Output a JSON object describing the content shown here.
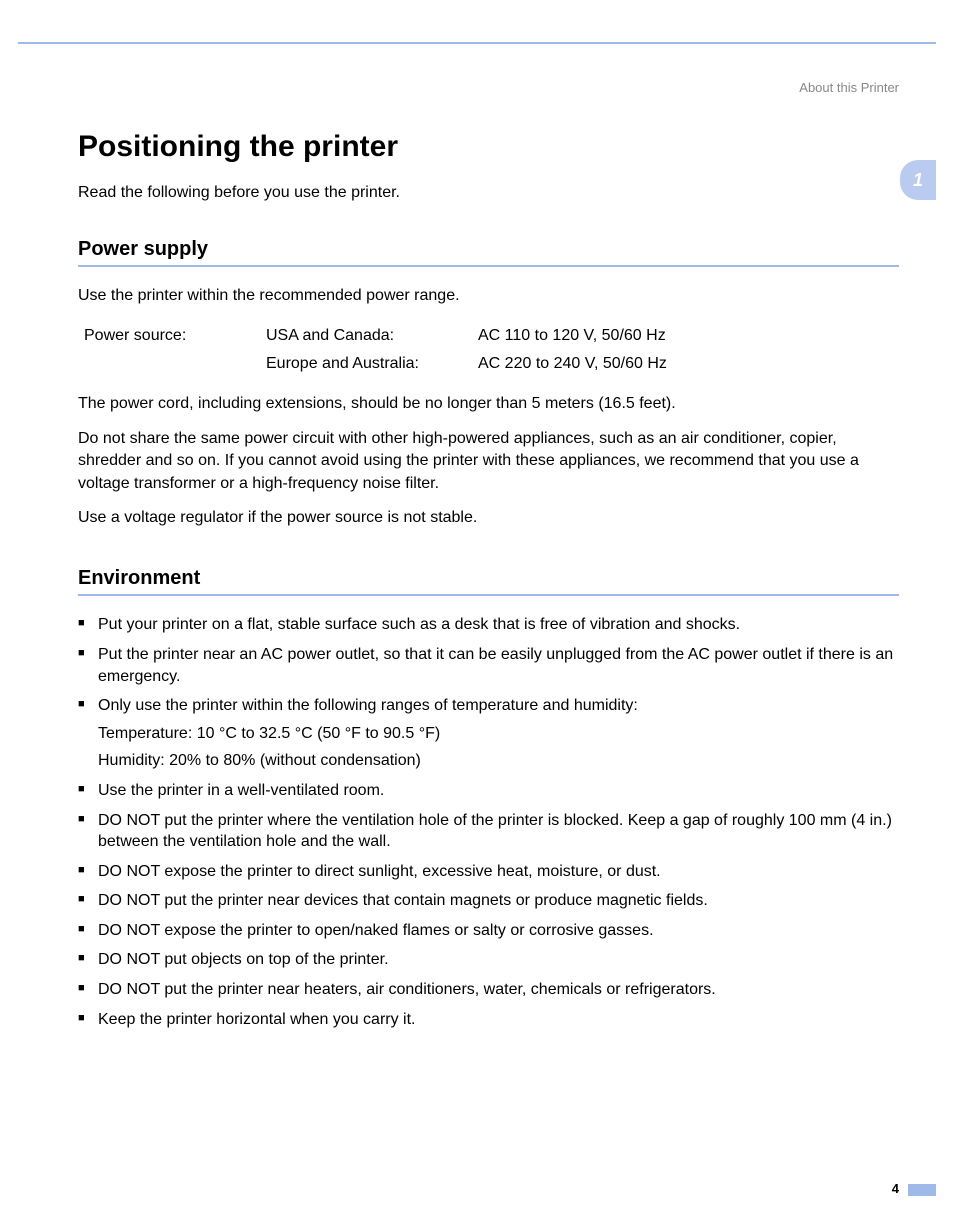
{
  "header": {
    "running_head": "About this Printer",
    "chapter_number": "1"
  },
  "title": "Positioning the printer",
  "intro": "Read the following before you use the printer.",
  "sections": {
    "power_supply": {
      "heading": "Power supply",
      "lead": "Use the printer within the recommended power range.",
      "table": {
        "label": "Power source:",
        "rows": [
          {
            "region": "USA and Canada:",
            "spec": "AC 110 to 120 V, 50/60 Hz"
          },
          {
            "region": "Europe and Australia:",
            "spec": "AC 220 to 240 V, 50/60 Hz"
          }
        ]
      },
      "paras": [
        "The power cord, including extensions, should be no longer than 5 meters (16.5 feet).",
        "Do not share the same power circuit with other high-powered appliances, such as an air conditioner, copier, shredder and so on. If you cannot avoid using the printer with these appliances, we recommend that you use a voltage transformer or a high-frequency noise filter.",
        "Use a voltage regulator if the power source is not stable."
      ]
    },
    "environment": {
      "heading": "Environment",
      "items": [
        {
          "text": "Put your printer on a flat, stable surface such as a desk that is free of vibration and shocks."
        },
        {
          "text": "Put the printer near an AC power outlet, so that it can be easily unplugged from the AC power outlet if there is an emergency."
        },
        {
          "text": "Only use the printer within the following ranges of temperature and humidity:",
          "sub": [
            "Temperature: 10 °C to 32.5 °C (50 °F to 90.5 °F)",
            "Humidity: 20% to 80% (without condensation)"
          ]
        },
        {
          "text": "Use the printer in a well-ventilated room."
        },
        {
          "text": "DO NOT put the printer where the ventilation hole of the printer is blocked. Keep a gap of roughly 100 mm (4 in.) between the ventilation hole and the wall."
        },
        {
          "text": "DO NOT expose the printer to direct sunlight, excessive heat, moisture, or dust."
        },
        {
          "text": "DO NOT put the printer near devices that contain magnets or produce magnetic fields."
        },
        {
          "text": "DO NOT expose the printer to open/naked flames or salty or corrosive gasses."
        },
        {
          "text": "DO NOT put objects on top of the printer."
        },
        {
          "text": "DO NOT put the printer near heaters, air conditioners, water, chemicals or refrigerators."
        },
        {
          "text": "Keep the printer horizontal when you carry it."
        }
      ]
    }
  },
  "page_number": "4"
}
